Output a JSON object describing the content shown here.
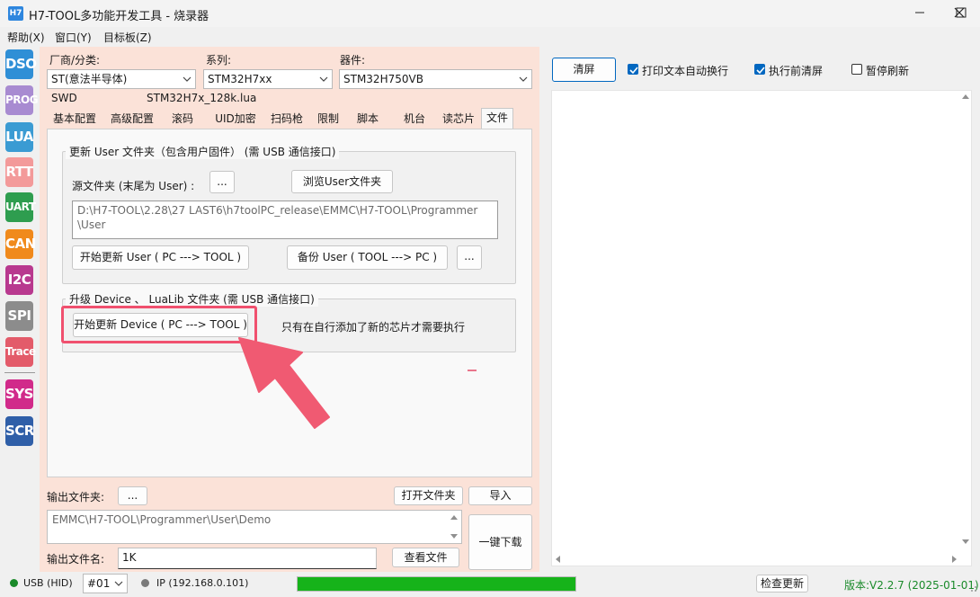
{
  "window": {
    "title": "H7-TOOL多功能开发工具 - 烧录器",
    "icon_text": "H7",
    "controls": [
      "minimize",
      "maximize",
      "close"
    ]
  },
  "menu": [
    "帮助(X)",
    "窗口(Y)",
    "目标板(Z)"
  ],
  "toolbar": [
    {
      "label": "DSO",
      "color": "#2f8fd6"
    },
    {
      "label": "PROG",
      "color": "#a88bd1"
    },
    {
      "label": "LUA",
      "color": "#3a9bd3"
    },
    {
      "label": "RTT",
      "color": "#f39a9a"
    },
    {
      "label": "UART",
      "color": "#2e9d4f"
    },
    {
      "label": "CAN",
      "color": "#f08a1c"
    },
    {
      "label": "I2C",
      "color": "#b8398f"
    },
    {
      "label": "SPI",
      "color": "#8c8c8c"
    },
    {
      "label": "Trace",
      "color": "#e35b6a"
    },
    {
      "label": "SYS",
      "color": "#d12a8a"
    },
    {
      "label": "SCR",
      "color": "#2f5fa8"
    }
  ],
  "selectors": {
    "vendor": {
      "label": "厂商/分类:",
      "value": "ST(意法半导体)"
    },
    "series": {
      "label": "系列:",
      "value": "STM32H7xx"
    },
    "device": {
      "label": "器件:",
      "value": "STM32H750VB"
    }
  },
  "info": {
    "interface": "SWD",
    "lua_file": "STM32H7x_128k.lua"
  },
  "tabs": [
    "基本配置",
    "高级配置",
    "滚码",
    "UID加密",
    "扫码枪",
    "限制",
    "脚本",
    "机台",
    "读芯片",
    "文件"
  ],
  "active_tab": "文件",
  "user_group": {
    "title": "更新 User 文件夹（包含用户固件）    (需 USB 通信接口)",
    "source_label": "源文件夹   (末尾为 User) :",
    "dots_button": "...",
    "browse_button": "浏览User文件夹",
    "path_line1": "D:\\H7-TOOL\\2.28\\27 LAST6\\h7toolPC_release\\EMMC\\H7-TOOL\\Programmer",
    "path_line2": "\\User",
    "start_update_button": "开始更新 User ( PC ---> TOOL )",
    "backup_button": "备份 User ( TOOL ---> PC )",
    "backup_dots_button": "..."
  },
  "device_group": {
    "title": "升级 Device 、 LuaLib 文件夹          (需 USB 通信接口)",
    "start_update_button": "开始更新 Device ( PC ---> TOOL )",
    "note": "只有在自行添加了新的芯片才需要执行"
  },
  "bottom": {
    "output_folder_label": "输出文件夹:",
    "dots_button": "...",
    "open_folder_button": "打开文件夹",
    "import_button": "导入",
    "output_path": "EMMC\\H7-TOOL\\Programmer\\User\\Demo",
    "one_click_button": "一键下载",
    "output_name_label": "输出文件名:",
    "output_name_value": "1K",
    "view_file_button": "查看文件"
  },
  "right": {
    "clear_button": "清屏",
    "checkbox_wrap": {
      "label": "打印文本自动换行",
      "checked": true
    },
    "checkbox_clear_before": {
      "label": "执行前清屏",
      "checked": true
    },
    "checkbox_pause": {
      "label": "暂停刷新",
      "checked": false
    }
  },
  "status": {
    "usb_label": "USB (HID)",
    "usb_color": "#1a8a2a",
    "port_value": "#01",
    "ip_label": "IP (192.168.0.101)",
    "ip_color": "#7a7a7a",
    "progress": 1.0,
    "progress_color": "#16b31a",
    "check_update_button": "检查更新",
    "version": "版本:V2.2.7 (2025-01-01)",
    "version_color": "#1a8a2a"
  },
  "colors": {
    "highlight": "#f0506e",
    "panel_bg": "#fbe2d8",
    "accent": "#0067c0"
  }
}
